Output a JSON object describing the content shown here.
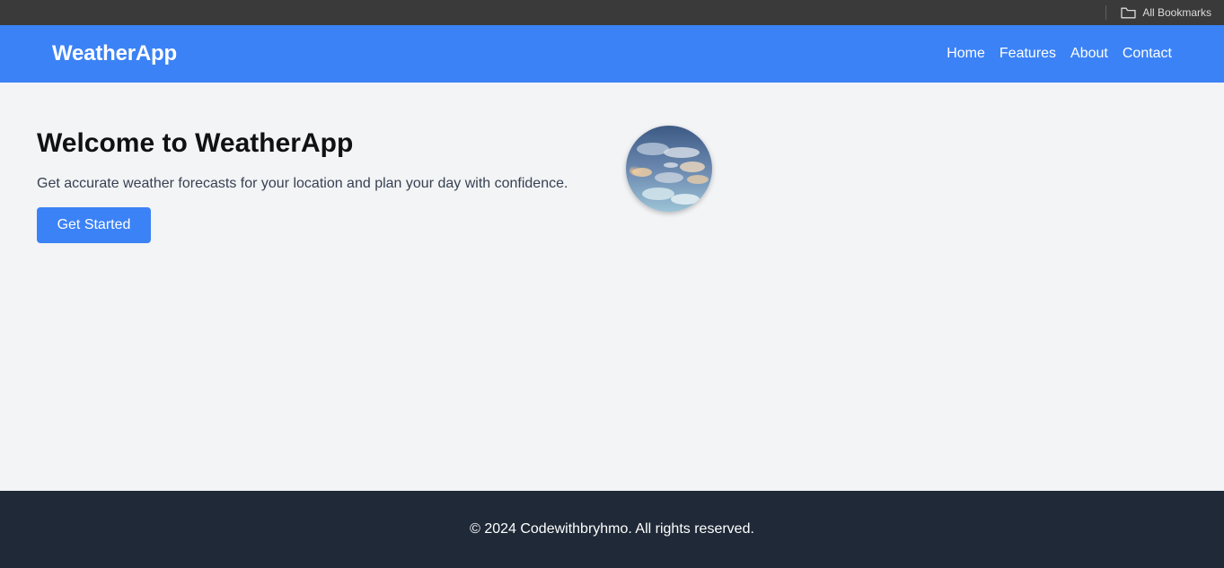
{
  "bookmarks_bar": {
    "all_bookmarks_label": "All Bookmarks",
    "folder_icon": "folder-icon"
  },
  "navbar": {
    "brand": "WeatherApp",
    "links": [
      "Home",
      "Features",
      "About",
      "Contact"
    ],
    "background_color": "#3b82f6"
  },
  "hero": {
    "title": "Welcome to WeatherApp",
    "subtitle": "Get accurate weather forecasts for your location and plan your day with confidence.",
    "cta_label": "Get Started",
    "image": "sky-clouds-image"
  },
  "footer": {
    "text": "© 2024 Codewithbryhmo. All rights reserved.",
    "background_color": "#1f2937"
  }
}
